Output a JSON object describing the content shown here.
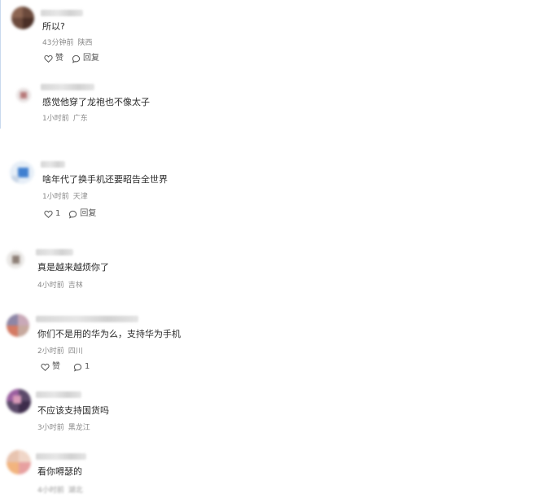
{
  "comments": [
    {
      "content": "所以?",
      "time": "43分钟前",
      "location": "陕西",
      "like_label": "赞",
      "reply_label": "回复"
    },
    {
      "content": "感觉他穿了龙袍也不像太子",
      "time": "1小时前",
      "location": "广东"
    },
    {
      "content": "啥年代了换手机还要昭告全世界",
      "time": "1小时前",
      "location": "天津",
      "like_label": "1",
      "reply_label": "回复"
    },
    {
      "content": "真是越来越烦你了",
      "time": "4小时前",
      "location": "吉林"
    },
    {
      "content": "你们不是用的华为么，支持华为手机",
      "time": "2小时前",
      "location": "四川",
      "like_label": "赞",
      "reply_label": "1"
    },
    {
      "content": "不应该支持国货吗",
      "time": "3小时前",
      "location": "黑龙江"
    },
    {
      "content": "看你嘚瑟的",
      "time": "4小时前",
      "location": "湖北"
    }
  ],
  "icons": {
    "like": "heart-outline-icon",
    "reply": "speech-bubble-icon"
  },
  "colors": {
    "text": "#2a2a2a",
    "meta": "#8a8a8a",
    "actions": "#555555"
  }
}
